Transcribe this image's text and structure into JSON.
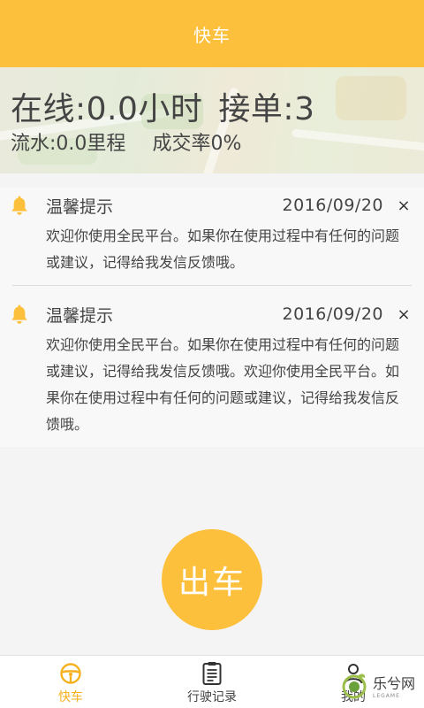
{
  "header": {
    "title": "快车"
  },
  "stats": {
    "online_label": "在线:",
    "online_value": "0.0",
    "online_unit": "小时",
    "orders_label": "接单:",
    "orders_value": "3",
    "flow_label": "流水:",
    "flow_value": "0.0",
    "flow_unit": "里程",
    "rate_label": "成交率",
    "rate_value": "0%"
  },
  "notices": [
    {
      "title": "温馨提示",
      "date": "2016/09/20",
      "close": "×",
      "body": "欢迎你使用全民平台。如果你在使用过程中有任何的问题或建议，记得给我发信反馈哦。"
    },
    {
      "title": "温馨提示",
      "date": "2016/09/20",
      "close": "×",
      "body": "欢迎你使用全民平台。如果你在使用过程中有任何的问题或建议，记得给我发信反馈哦。欢迎你使用全民平台。如果你在使用过程中有任何的问题或建议，记得给我发信反馈哦。"
    }
  ],
  "go_button": {
    "label": "出车"
  },
  "tabbar": {
    "items": [
      {
        "label": "快车",
        "icon": "steering-wheel-icon",
        "active": true
      },
      {
        "label": "行驶记录",
        "icon": "clipboard-icon",
        "active": false
      },
      {
        "label": "我的",
        "icon": "person-icon",
        "active": false
      }
    ]
  },
  "watermark": {
    "main": "乐兮网",
    "sub": "LEGAME"
  },
  "colors": {
    "accent": "#fdc03c",
    "active_tab": "#f5b11e",
    "text": "#444444"
  }
}
